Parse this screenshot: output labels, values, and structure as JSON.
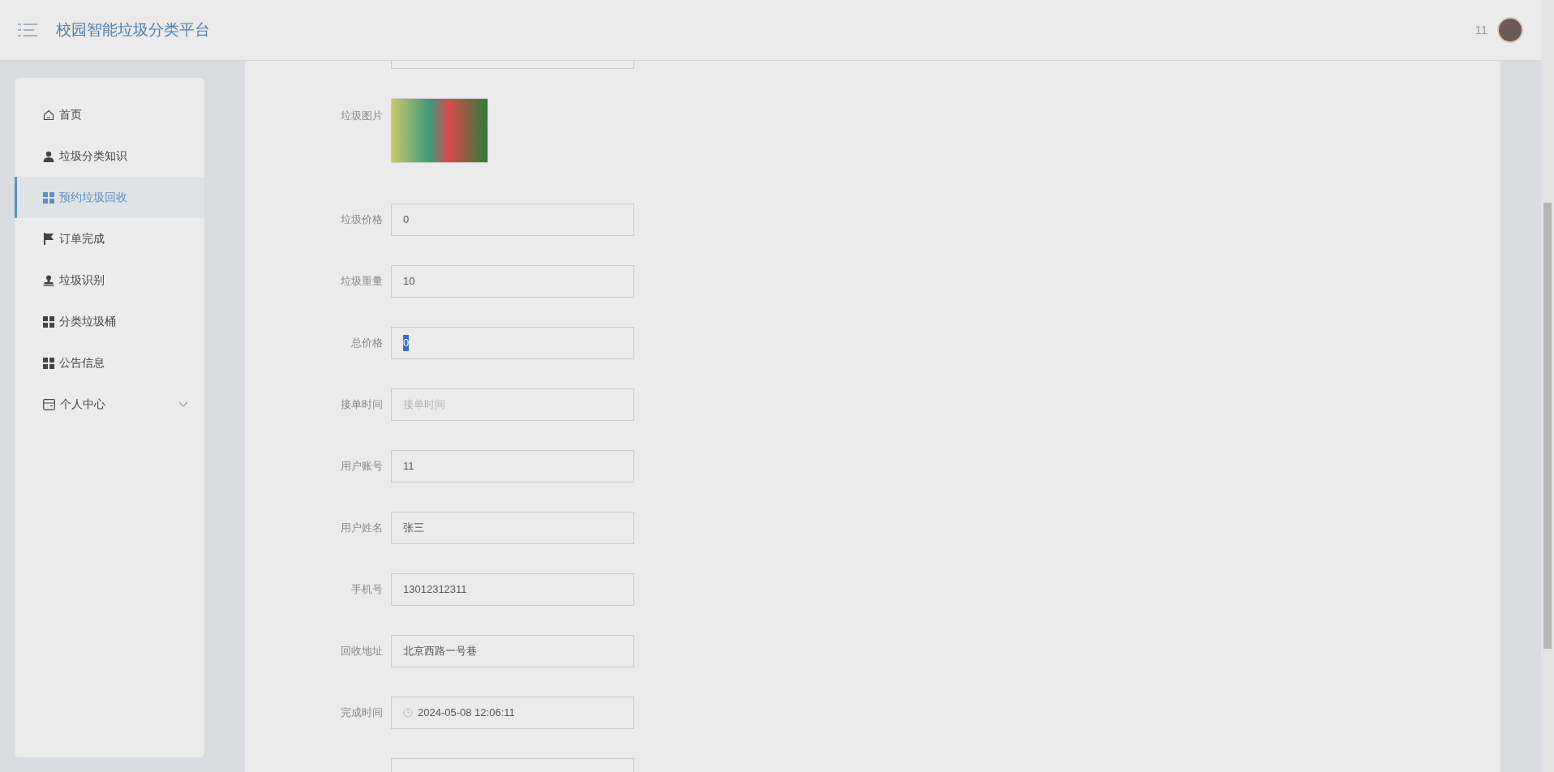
{
  "header": {
    "title": "校园智能垃圾分类平台",
    "username": "11"
  },
  "sidebar": {
    "items": [
      {
        "label": "首页",
        "kind": "home",
        "selected": false
      },
      {
        "label": "垃圾分类知识",
        "kind": "user",
        "selected": false
      },
      {
        "label": "预约垃圾回收",
        "kind": "grid",
        "selected": true
      },
      {
        "label": "订单完成",
        "kind": "flag",
        "selected": false
      },
      {
        "label": "垃圾识别",
        "kind": "stamp",
        "selected": false
      },
      {
        "label": "分类垃圾桶",
        "kind": "grid",
        "selected": false
      },
      {
        "label": "公告信息",
        "kind": "grid",
        "selected": false
      },
      {
        "label": "个人中心",
        "kind": "card",
        "selected": false,
        "expandable": true
      }
    ]
  },
  "form": {
    "fields": [
      {
        "kind": "partial"
      },
      {
        "kind": "image",
        "label": "垃圾图片"
      },
      {
        "kind": "text",
        "label": "垃圾价格",
        "value": "0"
      },
      {
        "kind": "text",
        "label": "垃圾重量",
        "value": "10"
      },
      {
        "kind": "text",
        "label": "总价格",
        "value": "0",
        "text_selected": true
      },
      {
        "kind": "text",
        "label": "接单时间",
        "placeholder": "接单时间"
      },
      {
        "kind": "text",
        "label": "用户账号",
        "value": "11"
      },
      {
        "kind": "text",
        "label": "用户姓名",
        "value": "张三"
      },
      {
        "kind": "text",
        "label": "手机号",
        "value": "13012312311"
      },
      {
        "kind": "text",
        "label": "回收地址",
        "value": "北京西路一号巷"
      },
      {
        "kind": "datetime",
        "label": "完成时间",
        "value": "2024-05-08 12:06:11"
      },
      {
        "kind": "partial"
      }
    ]
  }
}
